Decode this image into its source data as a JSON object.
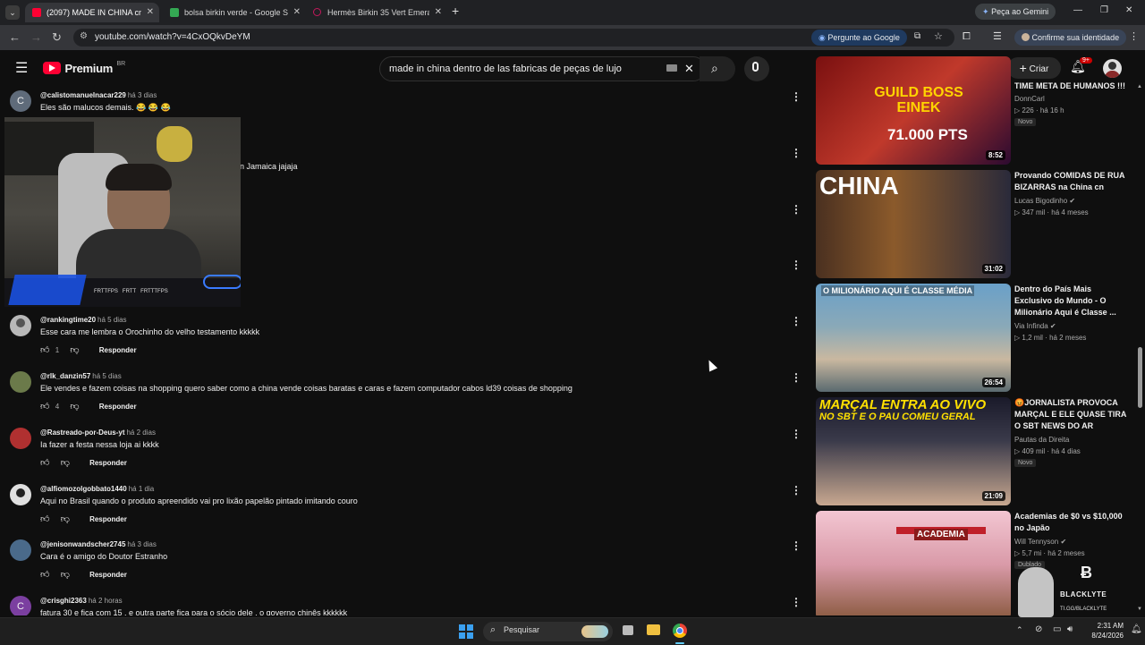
{
  "browser": {
    "tabs": [
      {
        "label": "(2097) MADE IN CHINA cn Den",
        "color": "#ff0033"
      },
      {
        "label": "bolsa birkin verde - Google Sh",
        "color": "#34a853"
      },
      {
        "label": "Hermès Birkin 35 Vert Emerald",
        "color": "#c2185b"
      }
    ],
    "new_tab": "+",
    "gemini": "Peça ao Gemini",
    "url": "youtube.com/watch?v=4CxOQkvDeYM",
    "ask_google": "Pergunte ao Google",
    "identity": "Confirme sua identidade"
  },
  "youtube": {
    "logo": "Premium",
    "region": "BR",
    "search_query": "made in china dentro de las fabricas de peças de lujo",
    "create": "Criar",
    "notif_count": "9+"
  },
  "overlay": {
    "partial_text": "n Jamaica jajaja",
    "socials": [
      "FRTTFPS",
      "FRTT",
      "FRTTTFPS"
    ]
  },
  "comments": [
    {
      "user": "@calistomanuelnacar229",
      "ago": "há 3 dias",
      "text": "Eles são malucos demais. 😂 😂 😂",
      "likes": "",
      "reply": "Responder",
      "avatar_letter": "C",
      "avatar_color": "#5f6b7a"
    },
    {
      "user": "@rankingtime20",
      "ago": "há 5 dias",
      "text": "Esse cara me lembra o Orochinho do velho testamento kkkkk",
      "likes": "1",
      "reply": "Responder",
      "avatar_letter": "",
      "avatar_color": "#9a9a9a"
    },
    {
      "user": "@rlk_danzin57",
      "ago": "há 5 dias",
      "text": "Ele vendes e fazem coisas na shopping quero saber como a china vende coisas baratas e caras e fazem computador cabos ld39 coisas de shopping",
      "likes": "4",
      "reply": "Responder",
      "avatar_letter": "",
      "avatar_color": "#6b7a4a"
    },
    {
      "user": "@Rastreado-por-Deus-yt",
      "ago": "há 2 dias",
      "text": "Ia fazer a festa nessa loja ai kkkk",
      "likes": "",
      "reply": "Responder",
      "avatar_letter": "",
      "avatar_color": "#b03030"
    },
    {
      "user": "@alfiomozolgobbato1440",
      "ago": "há 1 dia",
      "text": "Aqui no Brasil quando o produto apreendido vai pro lixão papelão pintado imitando couro",
      "likes": "",
      "reply": "Responder",
      "avatar_letter": "",
      "avatar_color": "#d0d0d0"
    },
    {
      "user": "@jenisonwandscher2745",
      "ago": "há 3 dias",
      "text": "Cara é o amigo do Doutor Estranho",
      "likes": "",
      "reply": "Responder",
      "avatar_letter": "",
      "avatar_color": "#4a6a8a"
    },
    {
      "user": "@crisghi2363",
      "ago": "há 2 horas",
      "text": "fatura 30 e fica com 15 , e outra parte fica para o sócio dele , o governo chinês kkkkkk",
      "likes": "",
      "reply": "",
      "avatar_letter": "C",
      "avatar_color": "#7b3fa0"
    }
  ],
  "related": [
    {
      "title": "TIME META DE HUMANOS !!!",
      "channel": "DonnCarl",
      "verified": false,
      "views": "226",
      "ago": "há 16 h",
      "badge": "Novo",
      "duration": "8:52",
      "thumb_text": "GUILD BOSS EINEK",
      "thumb_text2": "71.000 PTS"
    },
    {
      "title": "Provando COMIDAS DE RUA BIZARRAS na China cn",
      "channel": "Lucas Bigodinho",
      "verified": true,
      "views": "347 mil",
      "ago": "há 4 meses",
      "badge": "",
      "duration": "31:02",
      "thumb_text": "CHINA",
      "thumb_text2": ""
    },
    {
      "title": "Dentro do País Mais Exclusivo do Mundo - O Milionário Aqui é Classe ...",
      "channel": "Via Infinda",
      "verified": true,
      "views": "1,2 mil",
      "ago": "há 2 meses",
      "badge": "",
      "duration": "26:54",
      "thumb_text": "O MILIONÁRIO AQUI É CLASSE MÉDIA",
      "thumb_text2": ""
    },
    {
      "title": "😡JORNALISTA PROVOCA MARÇAL E ELE QUASE TIRA O SBT NEWS DO AR",
      "channel": "Pautas da Direita",
      "verified": false,
      "views": "409 mil",
      "ago": "há 4 dias",
      "badge": "Novo",
      "duration": "21:09",
      "thumb_text": "MARÇAL ENTRA AO VIVO",
      "thumb_text2": "NO SBT E O PAU COMEU GERAL"
    },
    {
      "title": "Academias de $0 vs $10,000 no Japão",
      "channel": "Will Tennyson",
      "verified": true,
      "views": "5,7 mi",
      "ago": "há 2 meses",
      "badge": "Dublado",
      "duration": "",
      "thumb_text": "ACADEMIA",
      "thumb_text2": ""
    }
  ],
  "watermark": {
    "brand": "BLACKLYTE",
    "link": "TI.GG/BLACKLYTE"
  },
  "taskbar": {
    "search": "Pesquisar",
    "time": "2:31 AM",
    "date": "8/24/2026"
  }
}
